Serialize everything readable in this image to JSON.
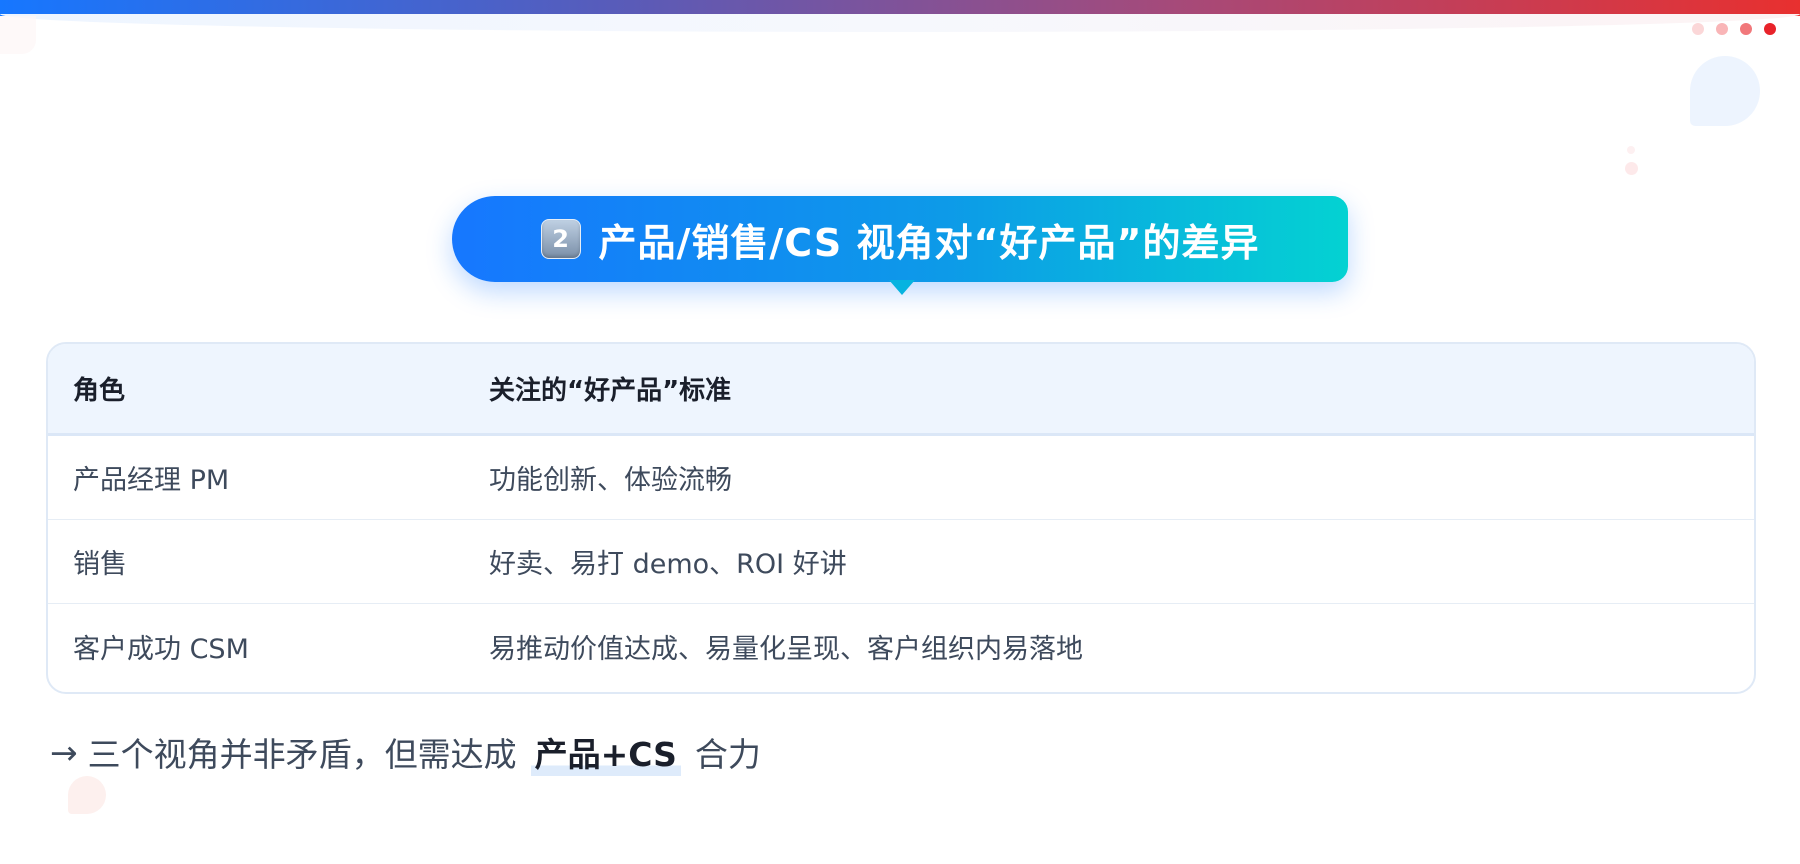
{
  "header": {
    "colors": {
      "gradient_start": "#1677ff",
      "gradient_end": "#e8302f"
    },
    "dot_colors": [
      "#fbd7d8",
      "#f9b5b7",
      "#f1787b",
      "#e8232a"
    ]
  },
  "title": {
    "badge": "2",
    "text": "产品/销售/CS 视角对“好产品”的差异"
  },
  "table": {
    "headers": [
      "角色",
      "关注的“好产品”标准"
    ],
    "rows": [
      {
        "role": "产品经理 PM",
        "criteria": "功能创新、体验流畅"
      },
      {
        "role": "销售",
        "criteria": "好卖、易打 demo、ROI 好讲"
      },
      {
        "role": "客户成功 CSM",
        "criteria": "易推动价值达成、易量化呈现、客户组织内易落地"
      }
    ]
  },
  "conclusion": {
    "arrow": "→",
    "prefix": "三个视角并非矛盾，但需达成",
    "highlight": "产品+CS",
    "suffix": "合力"
  }
}
